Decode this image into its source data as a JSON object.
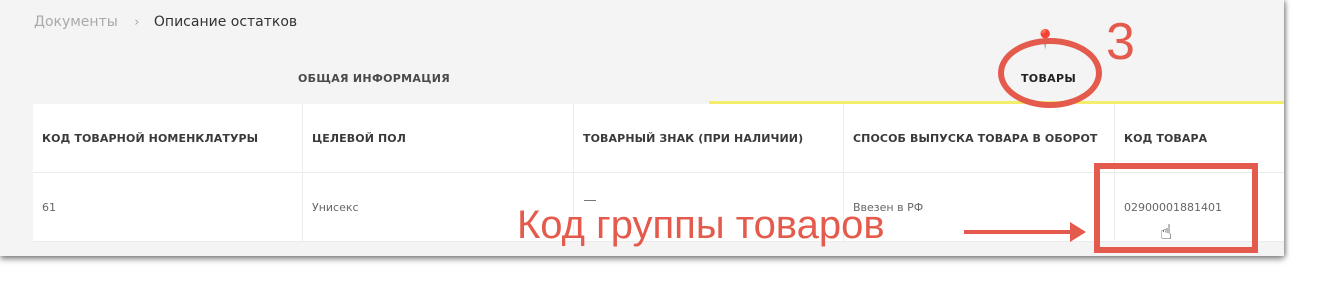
{
  "breadcrumb": {
    "parent": "Документы",
    "separator": "›",
    "current": "Описание остатков"
  },
  "tabs": [
    {
      "label": "ОБЩАЯ ИНФОРМАЦИЯ",
      "active": false
    },
    {
      "label": "ТОВАРЫ",
      "active": true
    }
  ],
  "table": {
    "columns": [
      "КОД ТОВАРНОЙ НОМЕНКЛАТУРЫ",
      "ЦЕЛЕВОЙ ПОЛ",
      "ТОВАРНЫЙ ЗНАК (ПРИ НАЛИЧИИ)",
      "СПОСОБ ВЫПУСКА ТОВАРА В ОБОРОТ",
      "КОД ТОВАРА"
    ],
    "rows": [
      [
        "61",
        "Унисекс",
        "",
        "Ввезен в РФ",
        "02900001881401"
      ]
    ]
  },
  "annotations": {
    "step_number": "3",
    "callout_label": "Код группы товаров",
    "color": "#e45a4c"
  },
  "icons": {
    "pin": "pin-icon",
    "cursor": "hand-cursor-icon"
  },
  "colors": {
    "active_tab_underline": "#f2ee6b",
    "panel_background": "#f4f4f4"
  }
}
